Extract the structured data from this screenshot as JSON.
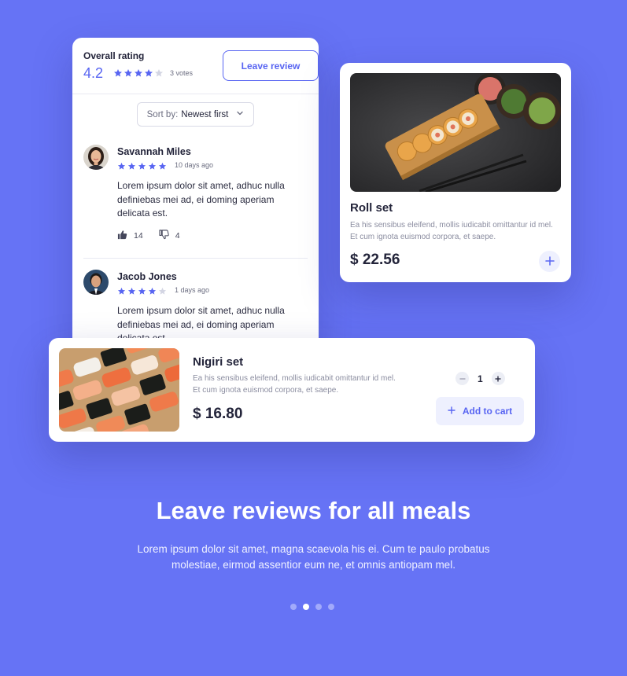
{
  "colors": {
    "background": "#6673f5",
    "accent": "#5865f2",
    "star_filled": "#5865f2",
    "star_empty": "#d3d5e3"
  },
  "reviews_card": {
    "overall_label": "Overall rating",
    "overall_score": "4.2",
    "overall_stars": 4,
    "votes": "3 votes",
    "leave_review_label": "Leave review",
    "sort_prefix": "Sort by:",
    "sort_value": "Newest first",
    "reviews": [
      {
        "name": "Savannah Miles",
        "stars": 5,
        "date": "10 days ago",
        "text": "Lorem ipsum dolor sit amet, adhuc nulla definiebas mei ad, ei doming aperiam delicata est.",
        "likes": "14",
        "dislikes": "4"
      },
      {
        "name": "Jacob Jones",
        "stars": 4,
        "date": "1 days ago",
        "text": "Lorem ipsum dolor sit amet, adhuc nulla definiebas mei ad, ei doming aperiam delicata est."
      }
    ]
  },
  "roll_card": {
    "title": "Roll set",
    "description": "Ea his sensibus eleifend, mollis iudicabit omittantur id mel. Et cum ignota euismod corpora, et saepe.",
    "price": "$ 22.56"
  },
  "nigiri_card": {
    "title": "Nigiri set",
    "description": "Ea his sensibus eleifend, mollis iudicabit omittantur id mel. Et cum ignota euismod corpora, et saepe.",
    "price": "$ 16.80",
    "quantity": "1",
    "add_to_cart_label": "Add to cart"
  },
  "hero": {
    "title": "Leave reviews for all meals",
    "subtitle": "Lorem ipsum dolor sit amet, magna scaevola his ei. Cum te paulo probatus molestiae, eirmod assentior eum ne, et omnis antiopam mel."
  },
  "pagination": {
    "total": 4,
    "active_index": 1
  }
}
